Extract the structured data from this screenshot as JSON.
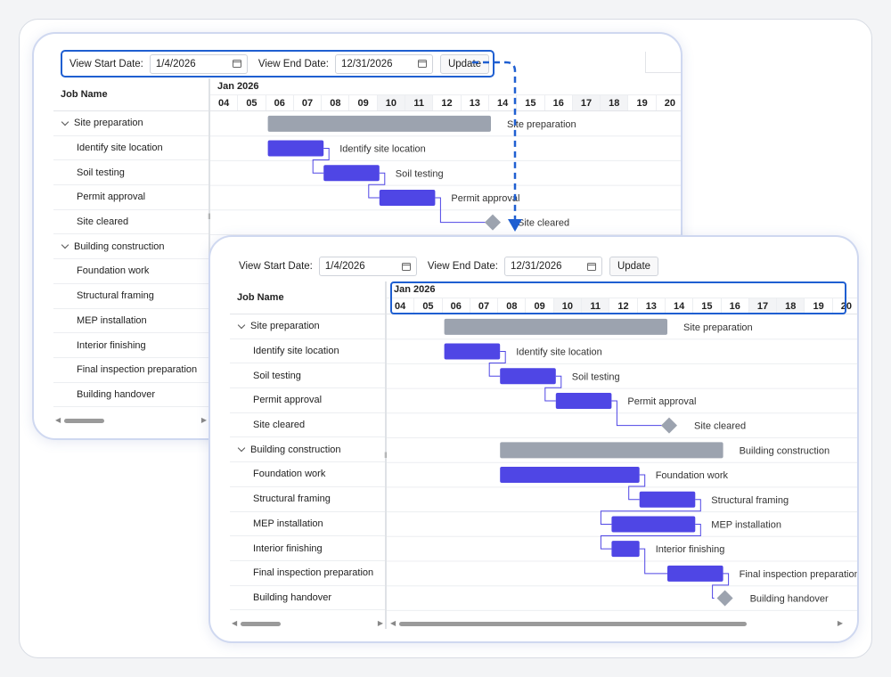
{
  "toolbar": {
    "start_label": "View Start Date:",
    "start_value": "1/4/2026",
    "end_label": "View End Date:",
    "end_value": "12/31/2026",
    "update_label": "Update"
  },
  "grid": {
    "header": "Job Name"
  },
  "timeline": {
    "month": "Jan 2026",
    "days": [
      "04",
      "05",
      "06",
      "07",
      "08",
      "09",
      "10",
      "11",
      "12",
      "13",
      "14",
      "15",
      "16",
      "17",
      "18",
      "19",
      "20"
    ],
    "weekend_days": [
      "10",
      "11",
      "17",
      "18"
    ]
  },
  "tasks": [
    {
      "name": "Site preparation",
      "level": 0,
      "type": "summary",
      "start": 2,
      "duration": 8
    },
    {
      "name": "Identify site location",
      "level": 1,
      "type": "task",
      "start": 2,
      "duration": 2
    },
    {
      "name": "Soil testing",
      "level": 1,
      "type": "task",
      "start": 4,
      "duration": 2
    },
    {
      "name": "Permit approval",
      "level": 1,
      "type": "task",
      "start": 6,
      "duration": 2
    },
    {
      "name": "Site cleared",
      "level": 1,
      "type": "milestone",
      "start": 10,
      "duration": 0
    },
    {
      "name": "Building construction",
      "level": 0,
      "type": "summary",
      "start": 4,
      "duration": 8
    },
    {
      "name": "Foundation work",
      "level": 1,
      "type": "task",
      "start": 4,
      "duration": 5
    },
    {
      "name": "Structural framing",
      "level": 1,
      "type": "task",
      "start": 9,
      "duration": 2
    },
    {
      "name": "MEP installation",
      "level": 1,
      "type": "task",
      "start": 8,
      "duration": 3
    },
    {
      "name": "Interior finishing",
      "level": 1,
      "type": "task",
      "start": 8,
      "duration": 1
    },
    {
      "name": "Final inspection preparation",
      "level": 1,
      "type": "task",
      "start": 10,
      "duration": 2
    },
    {
      "name": "Building handover",
      "level": 1,
      "type": "milestone",
      "start": 12,
      "duration": 0
    }
  ],
  "colors": {
    "task_bar": "#4f46e5",
    "summary_bar": "#9ca3af",
    "milestone": "#9ca3af",
    "connector": "#4f46e5",
    "highlight": "#1f5fd1"
  }
}
